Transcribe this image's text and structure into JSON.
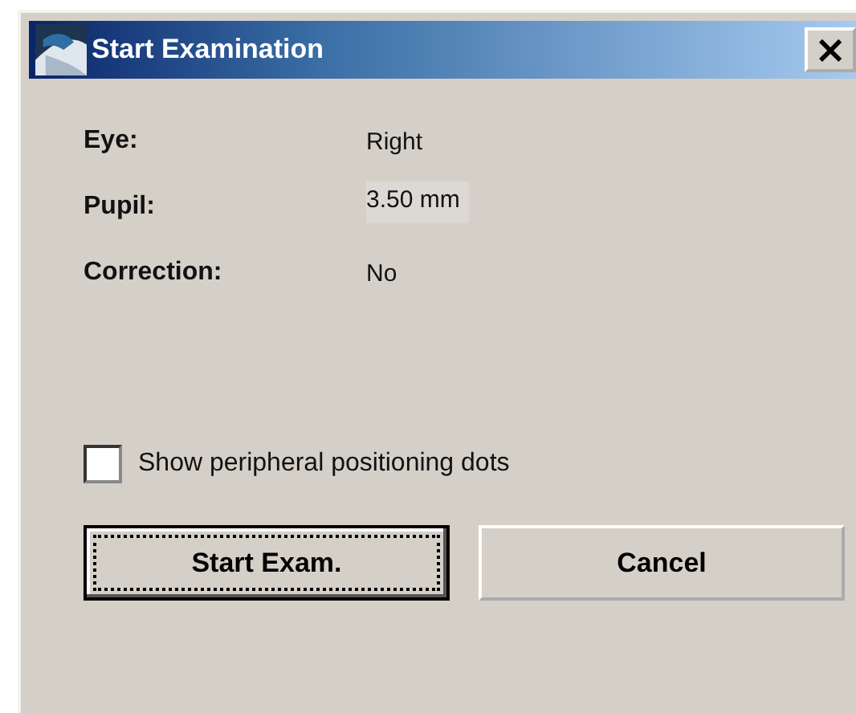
{
  "window": {
    "title": "Start Examination",
    "close": "×"
  },
  "rows": [
    {
      "label": "Eye:",
      "value": "Right",
      "kind": "text"
    },
    {
      "label": "Pupil:",
      "value": "3.50 mm",
      "kind": "field"
    },
    {
      "label": "Correction:",
      "value": "No",
      "kind": "text"
    }
  ],
  "checkbox": {
    "label": "Show peripheral positioning dots",
    "checked": false
  },
  "buttons": [
    {
      "label": "Start Exam.",
      "default": true
    },
    {
      "label": "Cancel",
      "default": false
    }
  ]
}
